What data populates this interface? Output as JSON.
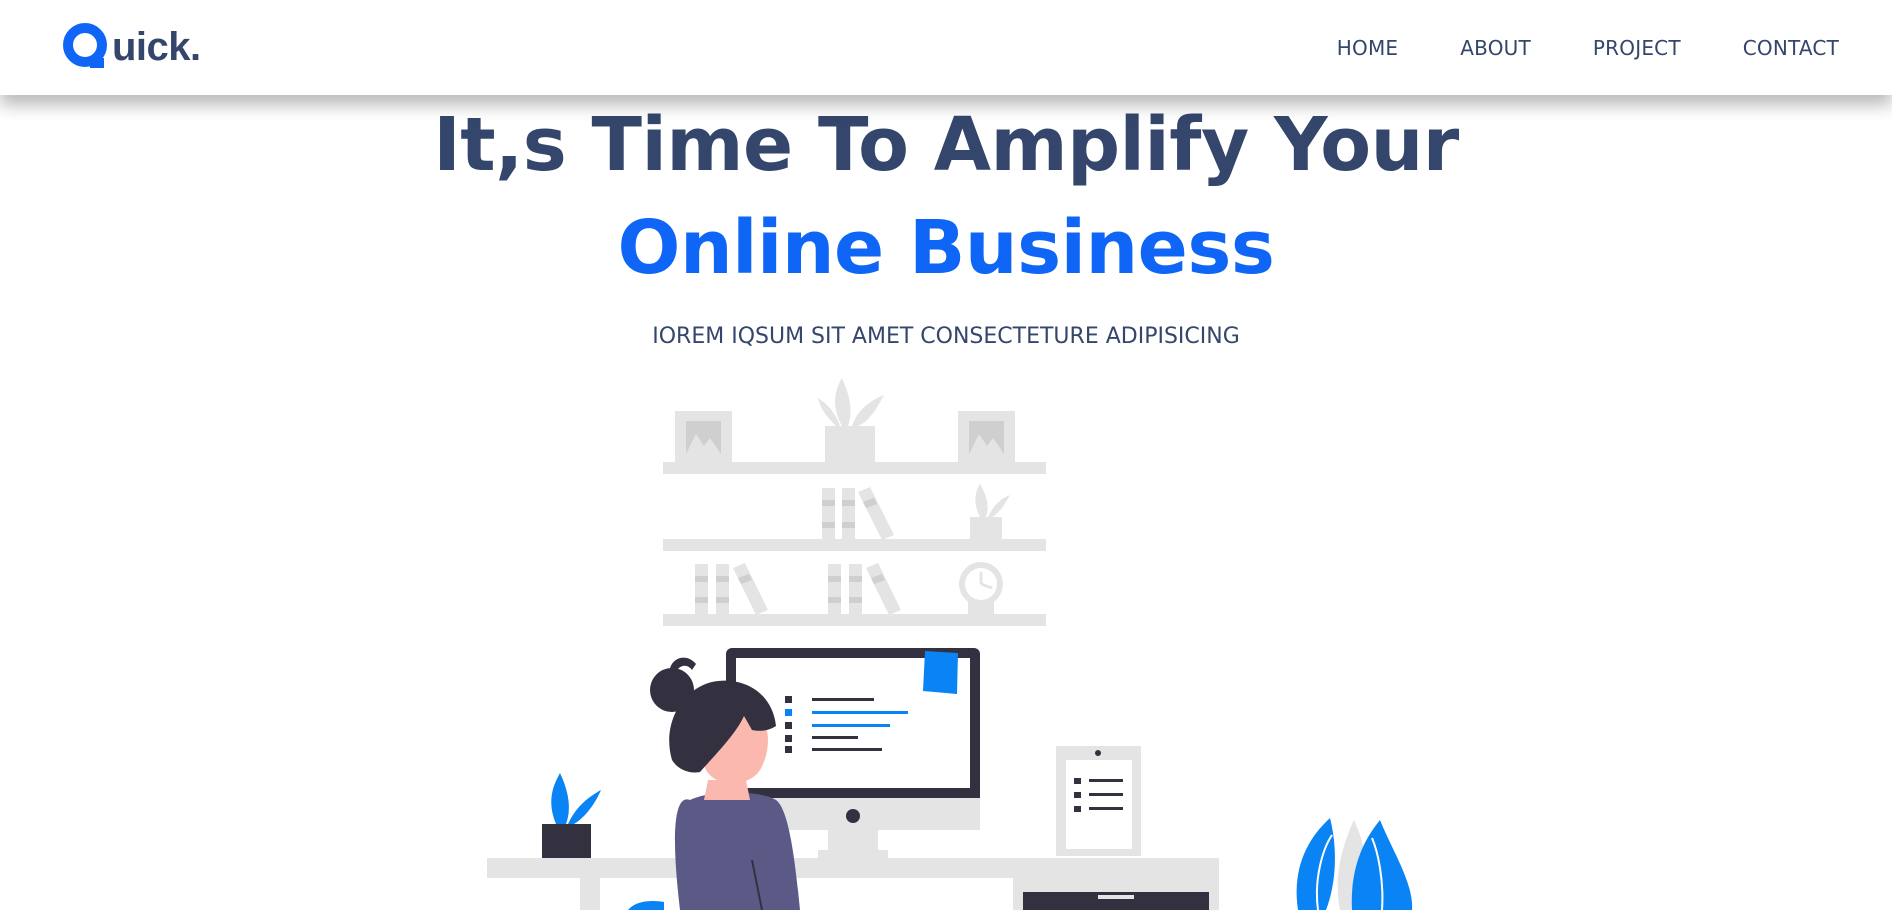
{
  "brand": {
    "name": "uick.",
    "logo_icon": "q-letter-icon",
    "accent_color": "#0f66f6",
    "text_color": "#34466b"
  },
  "nav": {
    "items": [
      {
        "label": "HOME"
      },
      {
        "label": "ABOUT"
      },
      {
        "label": "PROJECT"
      },
      {
        "label": "CONTACT"
      }
    ]
  },
  "hero": {
    "title_line1": "It,s Time To Amplify Your",
    "title_line2": "Online Business",
    "subtitle": "IOREM IQSUM SIT AMET CONSECTETURE ADIPISICING"
  },
  "illustration": {
    "name": "woman-working-at-desk-illustration",
    "shelf_color": "#e4e4e4",
    "accent_color": "#0a84f5",
    "dark_color": "#33303f",
    "sweater_color": "#5b5a87",
    "skin_color": "#fbb8ae"
  }
}
